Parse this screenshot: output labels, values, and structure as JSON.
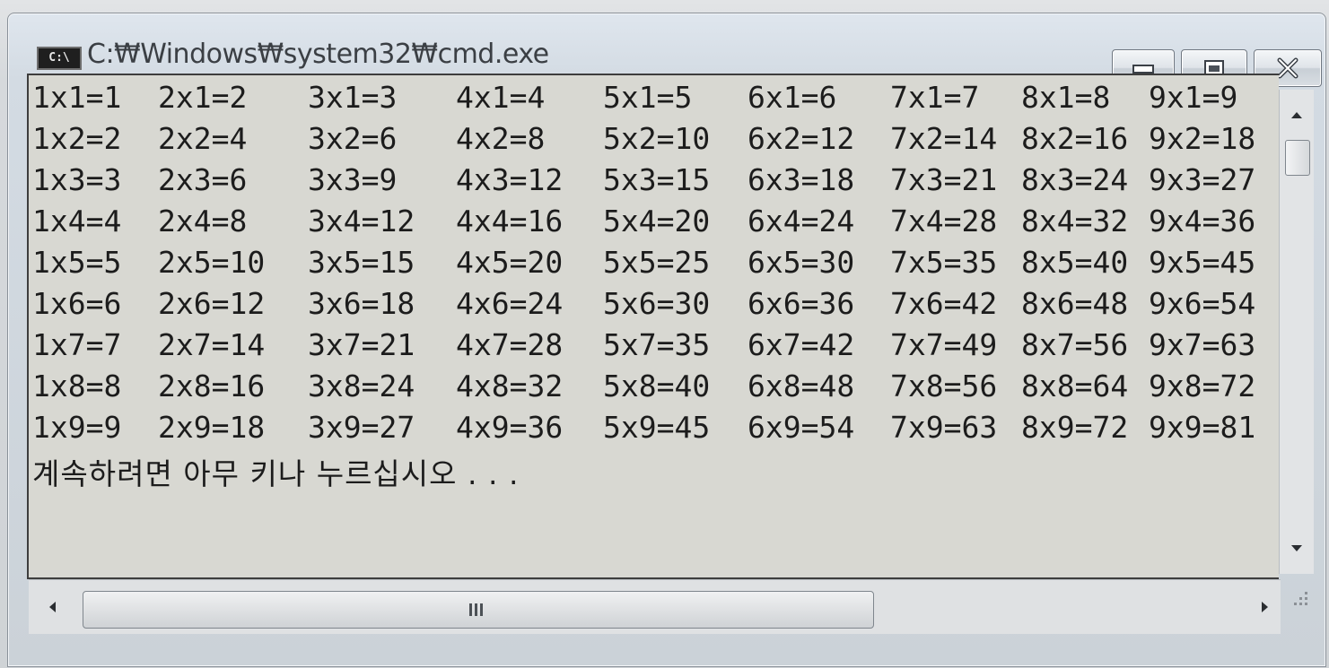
{
  "window": {
    "title": "C:₩Windows₩system32₩cmd.exe",
    "icon_label": "C:\\",
    "controls": [
      "minimize-icon",
      "maximize-icon",
      "close-icon"
    ]
  },
  "console": {
    "rows": [
      [
        "1x1=1",
        "2x1=2",
        "3x1=3",
        "4x1=4",
        "5x1=5",
        "6x1=6",
        "7x1=7",
        "8x1=8",
        "9x1=9"
      ],
      [
        "1x2=2",
        "2x2=4",
        "3x2=6",
        "4x2=8",
        "5x2=10",
        "6x2=12",
        "7x2=14",
        "8x2=16",
        "9x2=18"
      ],
      [
        "1x3=3",
        "2x3=6",
        "3x3=9",
        "4x3=12",
        "5x3=15",
        "6x3=18",
        "7x3=21",
        "8x3=24",
        "9x3=27"
      ],
      [
        "1x4=4",
        "2x4=8",
        "3x4=12",
        "4x4=16",
        "5x4=20",
        "6x4=24",
        "7x4=28",
        "8x4=32",
        "9x4=36"
      ],
      [
        "1x5=5",
        "2x5=10",
        "3x5=15",
        "4x5=20",
        "5x5=25",
        "6x5=30",
        "7x5=35",
        "8x5=40",
        "9x5=45"
      ],
      [
        "1x6=6",
        "2x6=12",
        "3x6=18",
        "4x6=24",
        "5x6=30",
        "6x6=36",
        "7x6=42",
        "8x6=48",
        "9x6=54"
      ],
      [
        "1x7=7",
        "2x7=14",
        "3x7=21",
        "4x7=28",
        "5x7=35",
        "6x7=42",
        "7x7=49",
        "8x7=56",
        "9x7=63"
      ],
      [
        "1x8=8",
        "2x8=16",
        "3x8=24",
        "4x8=32",
        "5x8=40",
        "6x8=48",
        "7x8=56",
        "8x8=64",
        "9x8=72"
      ],
      [
        "1x9=9",
        "2x9=18",
        "3x9=27",
        "4x9=36",
        "5x9=45",
        "6x9=54",
        "7x9=63",
        "8x9=72",
        "9x9=81"
      ]
    ],
    "prompt": "계속하려면 아무 키나 누르십시오 . . ."
  },
  "scrollbars": {
    "vertical_position": 0.02,
    "horizontal_position": 0.0,
    "horizontal_grip_label": "III"
  },
  "colors": {
    "console_background": "#d8d8d2",
    "console_text": "#1c1c1c",
    "title_text": "#3b3f44"
  }
}
